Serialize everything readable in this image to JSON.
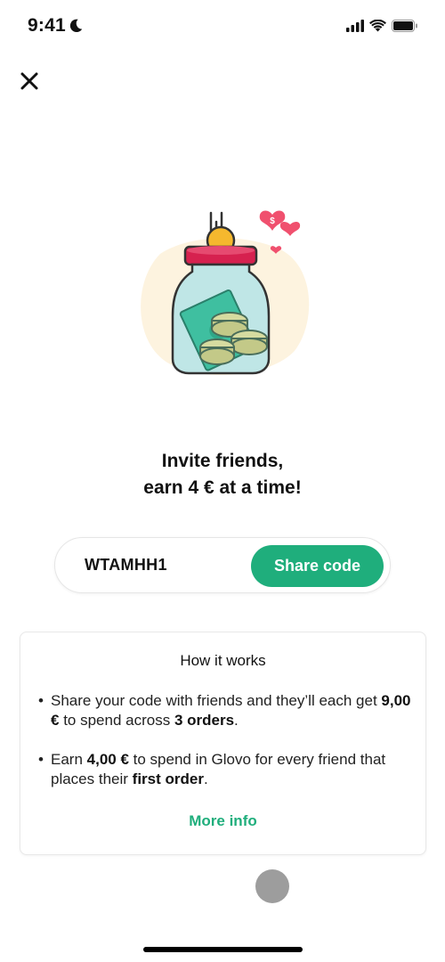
{
  "status_bar": {
    "time": "9:41",
    "icons": [
      "moon-icon",
      "signal-icon",
      "wifi-icon",
      "battery-icon"
    ]
  },
  "header": {
    "close_icon": "close-icon"
  },
  "hero": {
    "illustration": "piggy-jar-with-coins-illustration",
    "headline_line1": "Invite friends,",
    "headline_line2": "earn 4 € at a time!"
  },
  "code_box": {
    "code": "WTAMHH1",
    "share_label": "Share code"
  },
  "how_it_works": {
    "title": "How it works",
    "bullets": [
      {
        "parts": [
          {
            "text": "Share your code with friends and they’ll each get ",
            "bold": false
          },
          {
            "text": "9,00 €",
            "bold": true
          },
          {
            "text": " to spend across ",
            "bold": false
          },
          {
            "text": "3 orders",
            "bold": true
          },
          {
            "text": ".",
            "bold": false
          }
        ]
      },
      {
        "parts": [
          {
            "text": "Earn ",
            "bold": false
          },
          {
            "text": "4,00 €",
            "bold": true
          },
          {
            "text": " to spend in Glovo for every friend that places their ",
            "bold": false
          },
          {
            "text": "first order",
            "bold": true
          },
          {
            "text": ".",
            "bold": false
          }
        ]
      }
    ],
    "bullet_char": "•",
    "more_info_label": "More info"
  },
  "colors": {
    "accent": "#1fae7c",
    "jar_lid": "#d6214f",
    "coin": "#f5b82e",
    "heart": "#f0506e"
  }
}
